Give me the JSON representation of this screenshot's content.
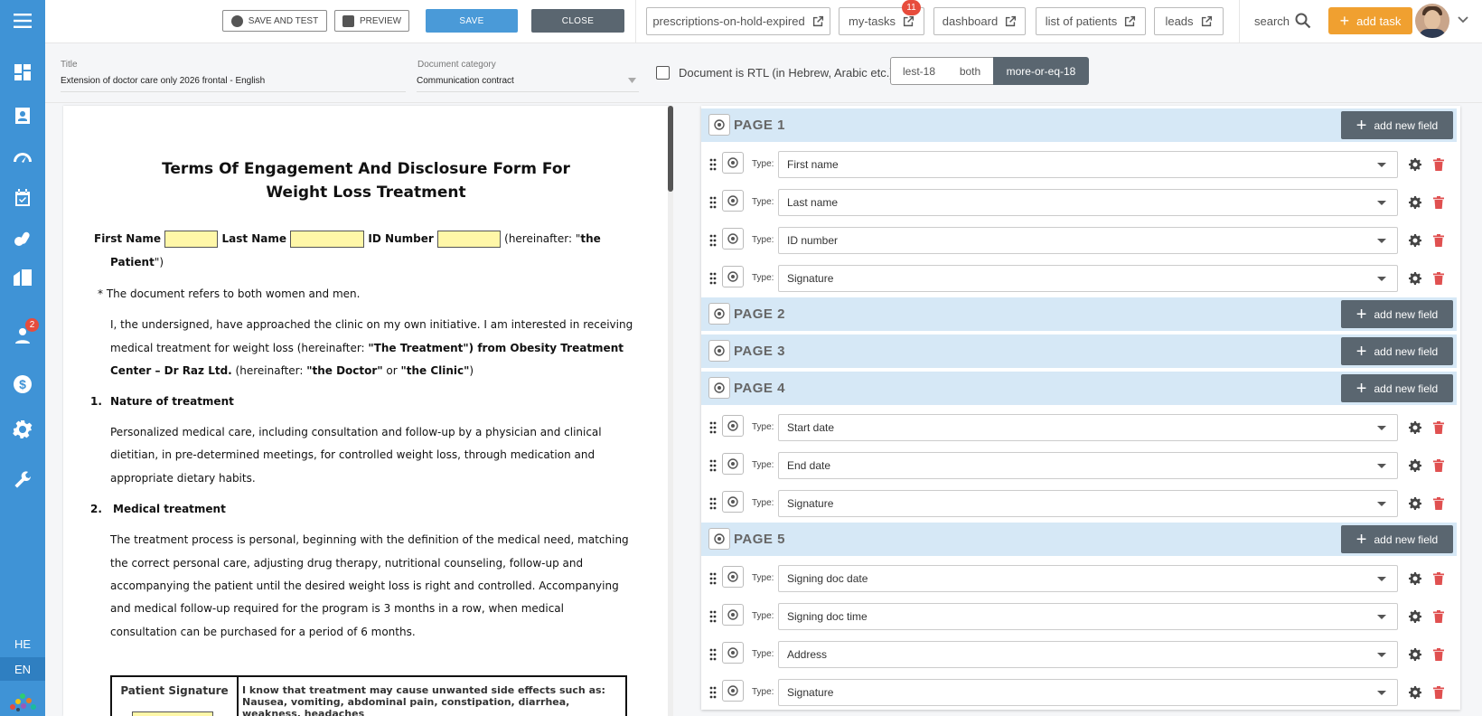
{
  "sidebar": {
    "badge_count": "2",
    "languages": [
      "HE",
      "EN"
    ]
  },
  "toolbar": {
    "save_and_test": "SAVE AND TEST",
    "preview": "PREVIEW",
    "save": "SAVE",
    "close": "CLOSE",
    "save_color": "#4a9ad8",
    "close_color": "#5a6670"
  },
  "quick_links": [
    {
      "label": "prescriptions-on-hold-expired"
    },
    {
      "label": "my-tasks",
      "badge": "11"
    },
    {
      "label": "dashboard"
    },
    {
      "label": "list of patients"
    },
    {
      "label": "leads"
    }
  ],
  "header": {
    "search_label": "search",
    "add_task": "add task",
    "add_task_color": "#f0a030"
  },
  "document": {
    "title_label": "Title",
    "title_value": "Extension of doctor care only 2026 frontal - English",
    "category_label": "Document category",
    "category_value": "Communication contract",
    "rtl_label": "Document is RTL (in Hebrew, Arabic etc.)",
    "rtl_checked": false,
    "age_options": [
      "lest-18",
      "both",
      "more-or-eq-18"
    ],
    "age_selected": "more-or-eq-18"
  },
  "preview_doc": {
    "title_line1": "Terms Of Engagement And Disclosure Form For",
    "title_line2": "Weight Loss Treatment",
    "first_name": "First Name",
    "last_name": "Last Name",
    "id_number": "ID Number",
    "hereinafter_a": "(hereinafter: \"",
    "the_patient_1": "the",
    "the_patient_2": "Patient",
    "close_paren": "\")",
    "note": "* The document refers to both women and men.",
    "intro_1": "I, the undersigned, have approached the clinic on my own initiative. I am interested in receiving",
    "intro_2a": "medical treatment for weight loss (hereinafter: ",
    "intro_2b": "\"The Treatment\") from Obesity Treatment",
    "intro_3a": "Center – Dr Raz Ltd.",
    "intro_3b": " (hereinafter: ",
    "intro_3c": "\"the Doctor\"",
    "intro_3d": " or ",
    "intro_3e": "\"the Clinic\"",
    "intro_3f": ")",
    "s1_num": "1.",
    "s1_title": "Nature of treatment",
    "s1_l1": "Personalized medical care, including consultation and follow-up by a physician and clinical",
    "s1_l2": "dietitian, in pre-determined meetings, for controlled weight loss, through medication and",
    "s1_l3": "appropriate dietary habits.",
    "s2_num": "2.",
    "s2_title": "Medical treatment",
    "s2_l1": "The treatment process is personal, beginning with the definition of the medical need, matching",
    "s2_l2": "the correct personal care, adjusting drug therapy, nutritional counseling, follow-up and",
    "s2_l3": "accompanying the patient until the desired weight loss is right and controlled. Accompanying",
    "s2_l4": "and medical follow-up required for the program is 3 months in a row, when medical",
    "s2_l5": "consultation can be purchased for a period of 6 months.",
    "table_c1": "Patient Signature",
    "table_c2": "I know that treatment may cause unwanted side effects such as: Nausea, vomiting, abdominal pain, constipation, diarrhea, weakness, headaches"
  },
  "fields_panel": {
    "type_label": "Type:",
    "add_new_field": "add new field",
    "pages": [
      {
        "label": "PAGE 1",
        "fields": [
          "First name",
          "Last name",
          "ID number",
          "Signature"
        ]
      },
      {
        "label": "PAGE 2",
        "fields": []
      },
      {
        "label": "PAGE 3",
        "fields": []
      },
      {
        "label": "PAGE 4",
        "fields": [
          "Start date",
          "End date",
          "Signature"
        ]
      },
      {
        "label": "PAGE 5",
        "fields": [
          "Signing doc date",
          "Signing doc time",
          "Address",
          "Signature"
        ]
      }
    ]
  }
}
